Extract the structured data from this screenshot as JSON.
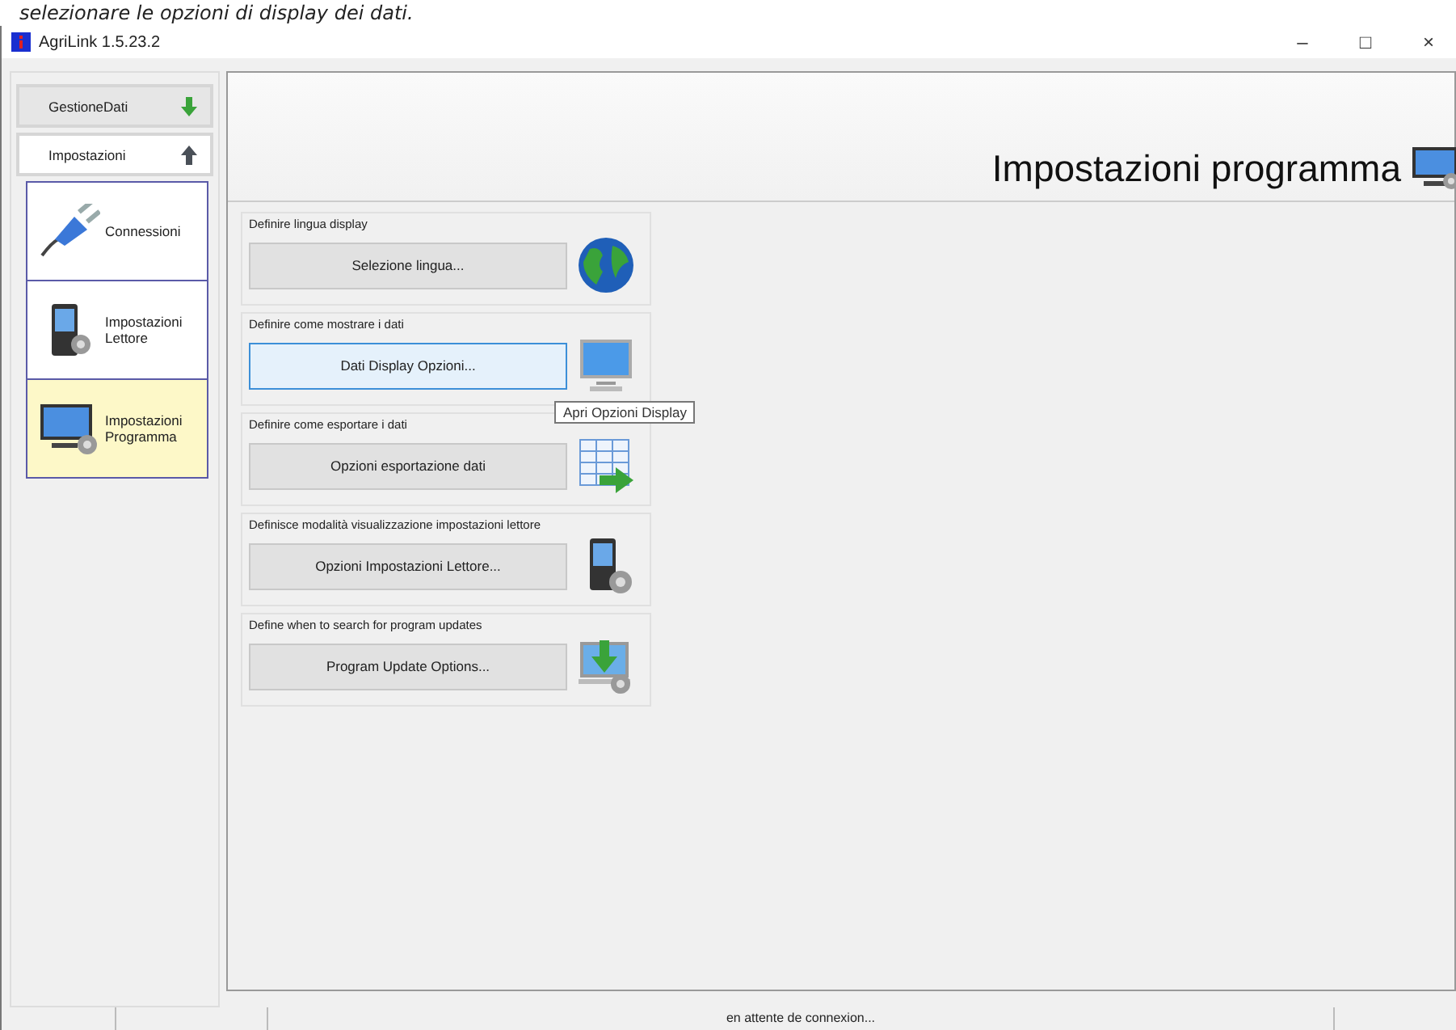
{
  "caption": "selezionare le opzioni di display dei dati.",
  "window": {
    "title": "AgriLink 1.5.23.2",
    "controls": [
      "–",
      "□",
      "×"
    ]
  },
  "sidebar": {
    "groups": [
      {
        "label": "GestioneDati",
        "expanded": false
      },
      {
        "label": "Impostazioni",
        "expanded": true
      }
    ],
    "items": [
      {
        "label": "Connessioni",
        "kind": "plug",
        "selected": false
      },
      {
        "label": "Impostazioni Lettore",
        "kind": "reader",
        "selected": false
      },
      {
        "label": "Impostazioni Programma",
        "kind": "monitor",
        "selected": true
      }
    ]
  },
  "header": {
    "title": "Impostazioni programma"
  },
  "sections": [
    {
      "legend": "Definire lingua display",
      "button": "Selezione lingua...",
      "kind": "globe",
      "highlighted": false
    },
    {
      "legend": "Definire come mostrare i dati",
      "button": "Dati Display Opzioni...",
      "kind": "monitor",
      "highlighted": true
    },
    {
      "legend": "Definire come esportare i dati",
      "button": "Opzioni esportazione dati",
      "kind": "export",
      "highlighted": false
    },
    {
      "legend": "Definisce modalità visualizzazione impostazioni lettore",
      "button": "Opzioni Impostazioni Lettore...",
      "kind": "reader",
      "highlighted": false
    },
    {
      "legend": "Define when to search for program updates",
      "button": "Program Update Options...",
      "kind": "update",
      "highlighted": false
    }
  ],
  "tooltip": "Apri Opzioni Display",
  "status_bar": {
    "text": "en attente de connexion..."
  }
}
